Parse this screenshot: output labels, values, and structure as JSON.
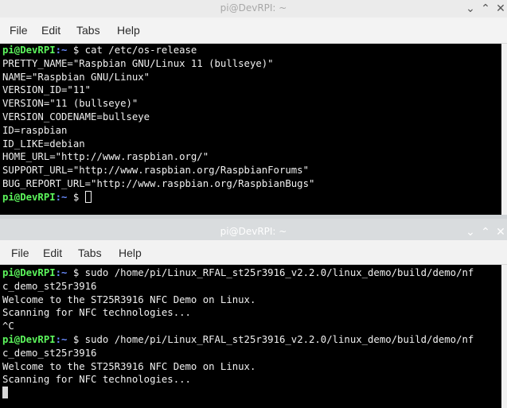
{
  "windows": [
    {
      "title": "pi@DevRPI: ~",
      "menu": [
        "File",
        "Edit",
        "Tabs",
        "Help"
      ],
      "controls": {
        "minimize": "⌄",
        "maximize": "⌃",
        "close": "✕"
      },
      "lines": [
        {
          "prompt": {
            "user": "pi@DevRPI",
            "path": ":~",
            "sym": " $ "
          },
          "text": "cat /etc/os-release"
        },
        {
          "text": "PRETTY_NAME=\"Raspbian GNU/Linux 11 (bullseye)\""
        },
        {
          "text": "NAME=\"Raspbian GNU/Linux\""
        },
        {
          "text": "VERSION_ID=\"11\""
        },
        {
          "text": "VERSION=\"11 (bullseye)\""
        },
        {
          "text": "VERSION_CODENAME=bullseye"
        },
        {
          "text": "ID=raspbian"
        },
        {
          "text": "ID_LIKE=debian"
        },
        {
          "text": "HOME_URL=\"http://www.raspbian.org/\""
        },
        {
          "text": "SUPPORT_URL=\"http://www.raspbian.org/RaspbianForums\""
        },
        {
          "text": "BUG_REPORT_URL=\"http://www.raspbian.org/RaspbianBugs\""
        },
        {
          "prompt": {
            "user": "pi@DevRPI",
            "path": ":~",
            "sym": " $ "
          },
          "text": "",
          "cursor": "outline"
        }
      ]
    },
    {
      "title": "pi@DevRPI: ~",
      "menu": [
        "File",
        "Edit",
        "Tabs",
        "Help"
      ],
      "controls": {
        "minimize": "⌄",
        "maximize": "⌃",
        "close": "✕"
      },
      "lines": [
        {
          "prompt": {
            "user": "pi@DevRPI",
            "path": ":~",
            "sym": " $ "
          },
          "text": "sudo /home/pi/Linux_RFAL_st25r3916_v2.2.0/linux_demo/build/demo/nf"
        },
        {
          "text": "c_demo_st25r3916"
        },
        {
          "text": "Welcome to the ST25R3916 NFC Demo on Linux."
        },
        {
          "text": "Scanning for NFC technologies..."
        },
        {
          "text": "^C"
        },
        {
          "prompt": {
            "user": "pi@DevRPI",
            "path": ":~",
            "sym": " $ "
          },
          "text": "sudo /home/pi/Linux_RFAL_st25r3916_v2.2.0/linux_demo/build/demo/nf"
        },
        {
          "text": "c_demo_st25r3916"
        },
        {
          "text": "Welcome to the ST25R3916 NFC Demo on Linux."
        },
        {
          "text": "Scanning for NFC technologies..."
        },
        {
          "text": "",
          "cursor": "block"
        }
      ]
    }
  ]
}
